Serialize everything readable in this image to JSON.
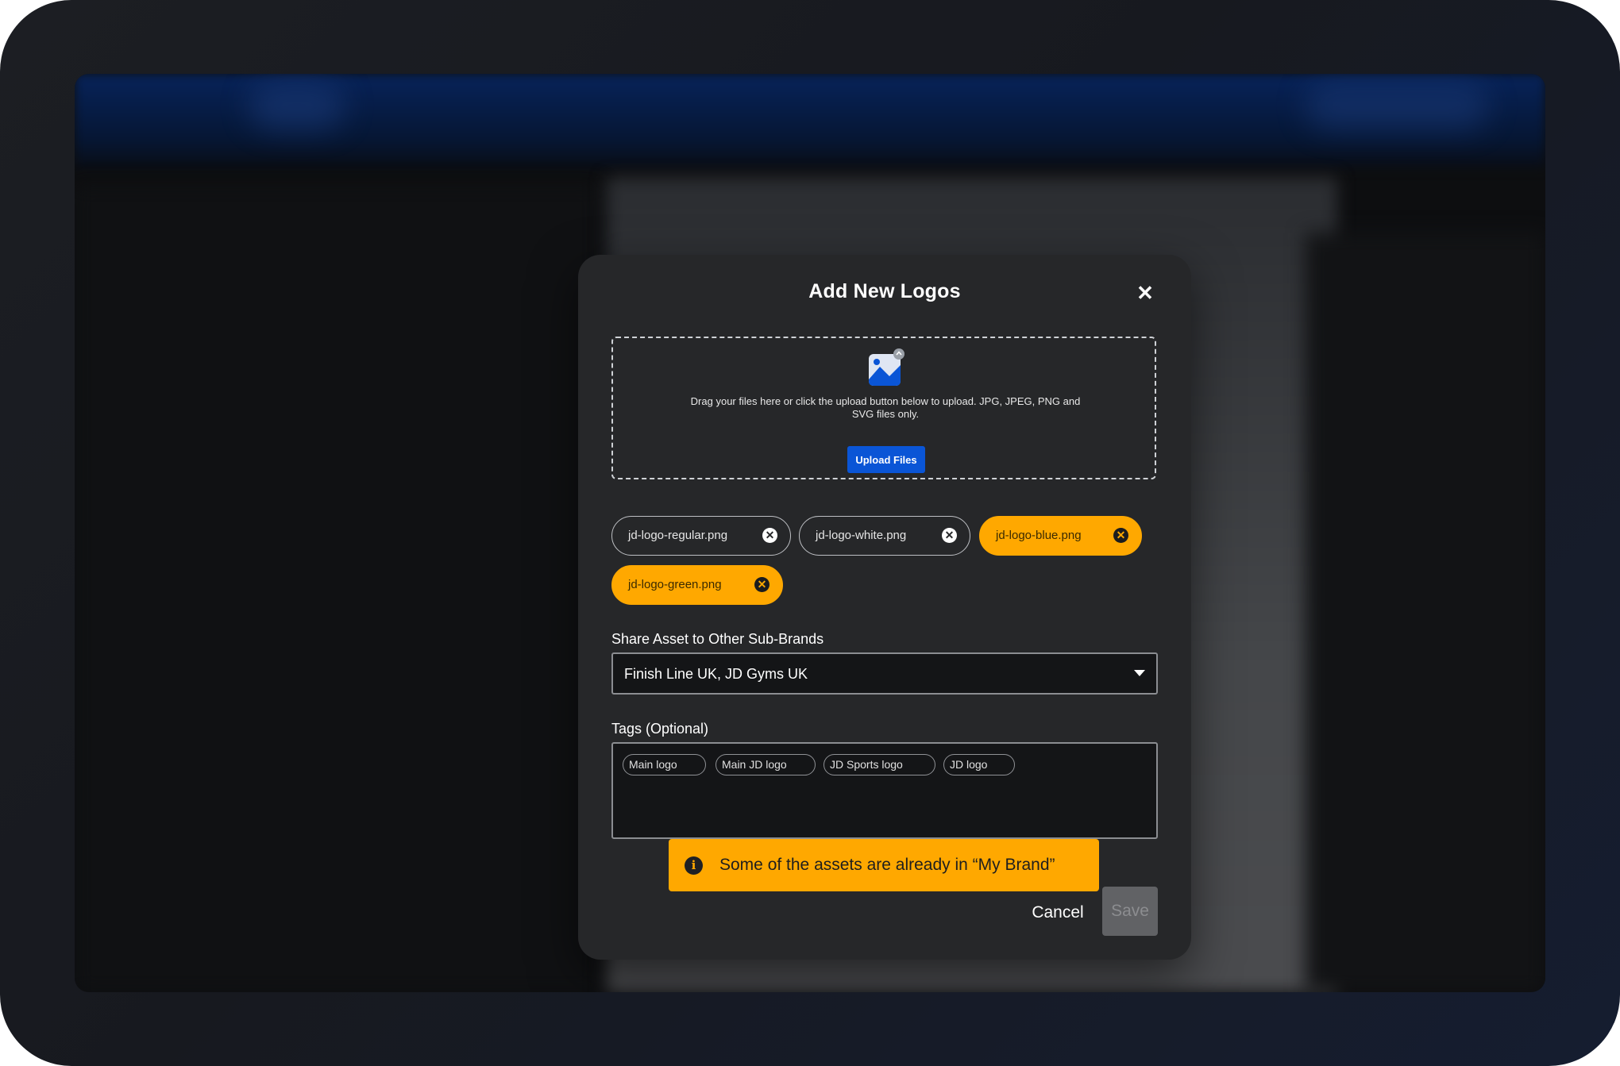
{
  "modal": {
    "title": "Add New Logos",
    "close_icon": "close-icon"
  },
  "dropzone": {
    "icon": "image-upload-icon",
    "text": "Drag your files here or click the upload button below to upload. JPG, JPEG, PNG and SVG files only.",
    "button_label": "Upload Files"
  },
  "files": [
    {
      "name": "jd-logo-regular.png",
      "status": "normal"
    },
    {
      "name": "jd-logo-white.png",
      "status": "normal"
    },
    {
      "name": "jd-logo-blue.png",
      "status": "warning"
    },
    {
      "name": "jd-logo-green.png",
      "status": "warning"
    }
  ],
  "share": {
    "label": "Share Asset to Other Sub-Brands",
    "value": "Finish Line UK, JD Gyms UK"
  },
  "tags": {
    "label": "Tags (Optional)",
    "items": [
      "Main logo",
      "Main JD logo",
      "JD Sports logo",
      "JD logo"
    ]
  },
  "toast": {
    "icon": "info-icon",
    "text": "Some of the assets are already in “My Brand”"
  },
  "actions": {
    "cancel_label": "Cancel",
    "save_label": "Save"
  },
  "colors": {
    "warning": "#ffa800",
    "primary": "#0a55d6",
    "modal_bg": "#262729"
  }
}
